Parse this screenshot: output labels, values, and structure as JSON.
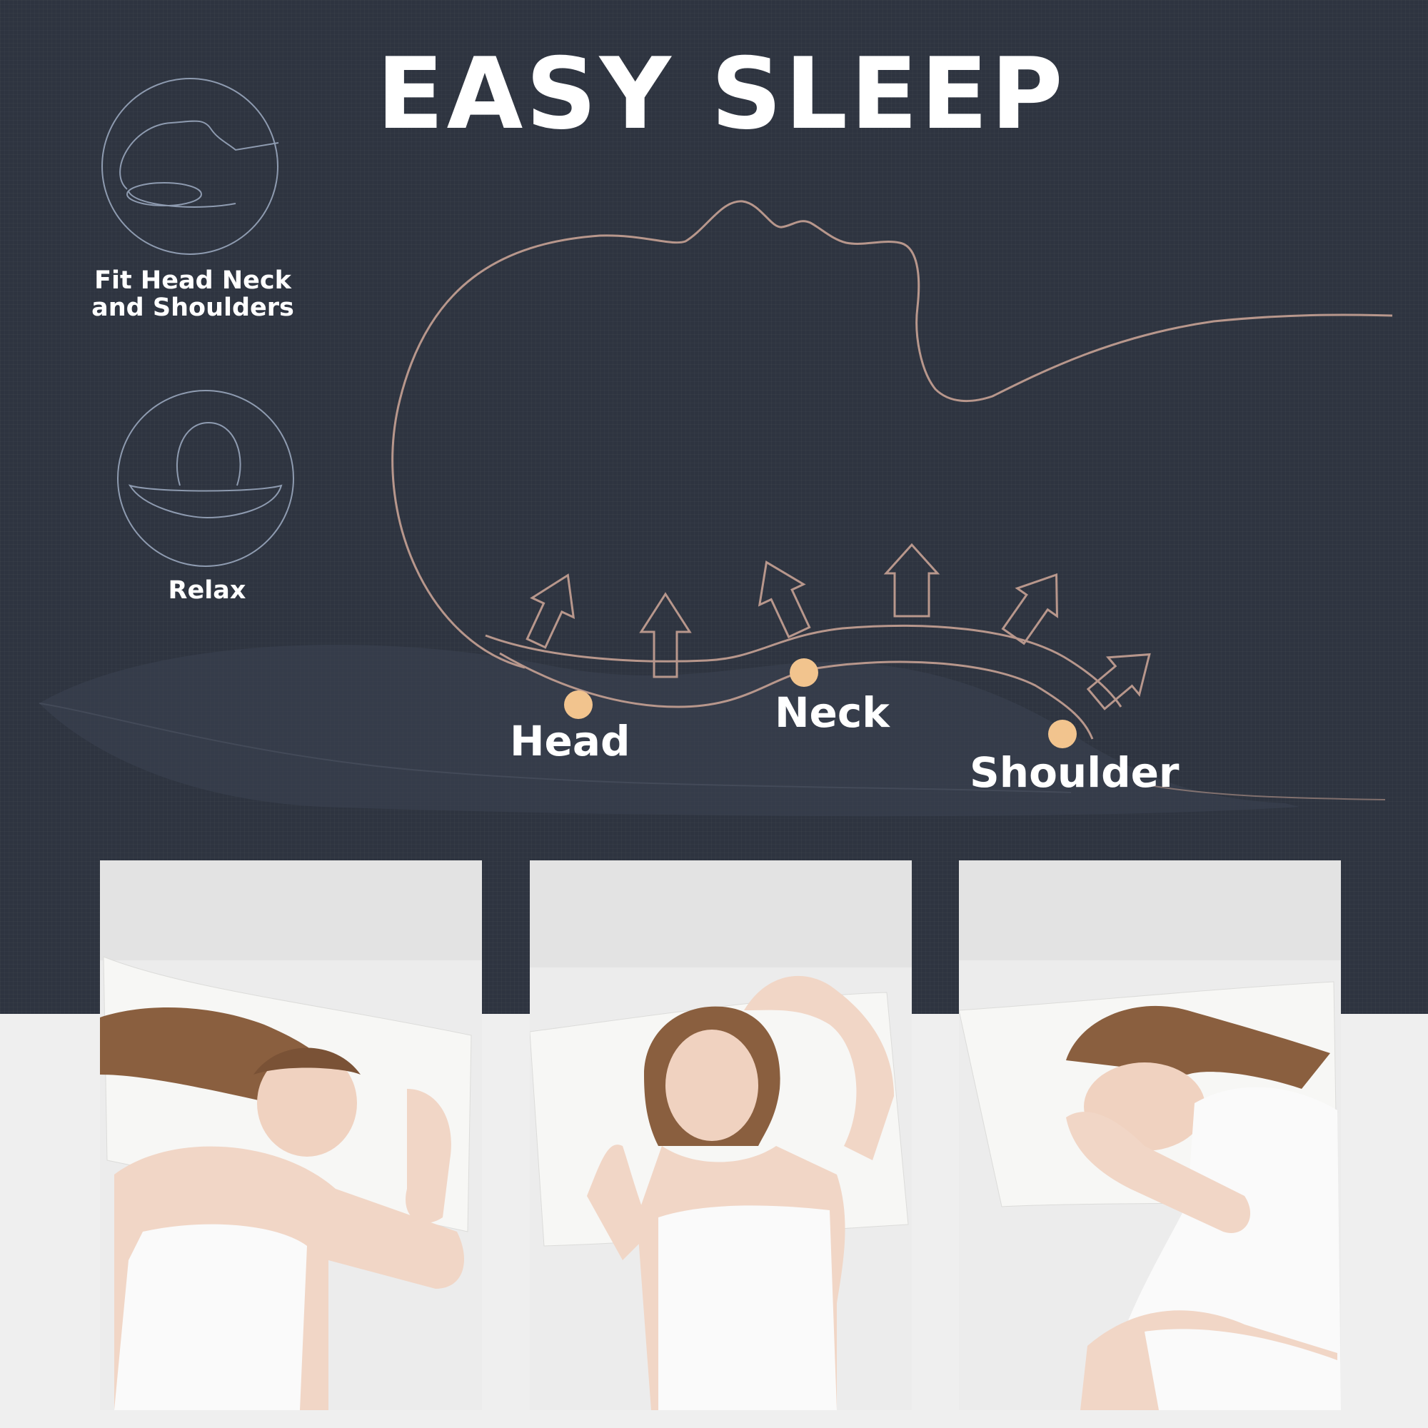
{
  "title": "EASY SLEEP",
  "features": [
    {
      "label_line1": "Fit Head Neck",
      "label_line2": "and Shoulders",
      "icon": "pillow-head-neck-icon"
    },
    {
      "label": "Relax",
      "icon": "relax-head-icon"
    }
  ],
  "callouts": {
    "head": "Head",
    "neck": "Neck",
    "shoulder": "Shoulder"
  },
  "colors": {
    "background_dark": "#2e3440",
    "background_light": "#efefef",
    "contour_line": "#b8978c",
    "dot": "#f2c48e",
    "text": "#ffffff"
  },
  "photos": [
    {
      "name": "side-sleeping-photo",
      "pose": "side"
    },
    {
      "name": "back-sleeping-photo",
      "pose": "back"
    },
    {
      "name": "curled-side-sleeping-photo",
      "pose": "curled"
    }
  ]
}
